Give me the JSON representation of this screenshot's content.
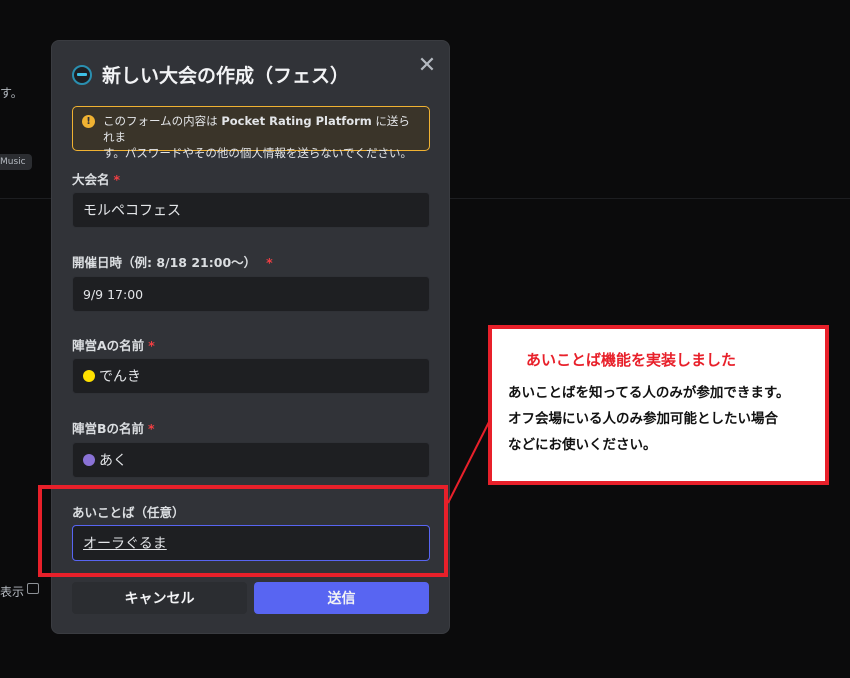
{
  "background": {
    "partial_text_1": "す。",
    "chip_label": "Music",
    "partial_text_2": "表示"
  },
  "modal": {
    "title": "新しい大会の作成（フェス）",
    "warning": {
      "line1_prefix": "このフォームの内容は ",
      "line1_bold": "Pocket Rating Platform",
      "line1_suffix": " に送られま",
      "line2": "す。パスワードやその他の個人情報を送らないでください。"
    },
    "fields": {
      "name": {
        "label": "大会名",
        "value": "モルペコフェス"
      },
      "date": {
        "label": "開催日時（例: 8/18 21:00～）",
        "value": "9/9 17:00"
      },
      "team_a": {
        "label": "陣営Aの名前",
        "value": "でんき",
        "dot_color": "#ffe100"
      },
      "team_b": {
        "label": "陣営Bの名前",
        "value": "あく",
        "dot_color": "#8a72d6"
      },
      "password": {
        "label": "あいことば（任意）",
        "value": "オーラぐるま"
      }
    },
    "required_mark": "*",
    "buttons": {
      "cancel": "キャンセル",
      "submit": "送信"
    }
  },
  "callout": {
    "title": "あいことば機能を実装しました",
    "lines": [
      "あいことばを知ってる人のみが参加できます。",
      "オフ会場にいる人のみ参加可能としたい場合",
      "などにお使いください。"
    ]
  },
  "colors": {
    "accent": "#5865f2",
    "annotation_red": "#e8202a",
    "warning": "#f0b232"
  }
}
